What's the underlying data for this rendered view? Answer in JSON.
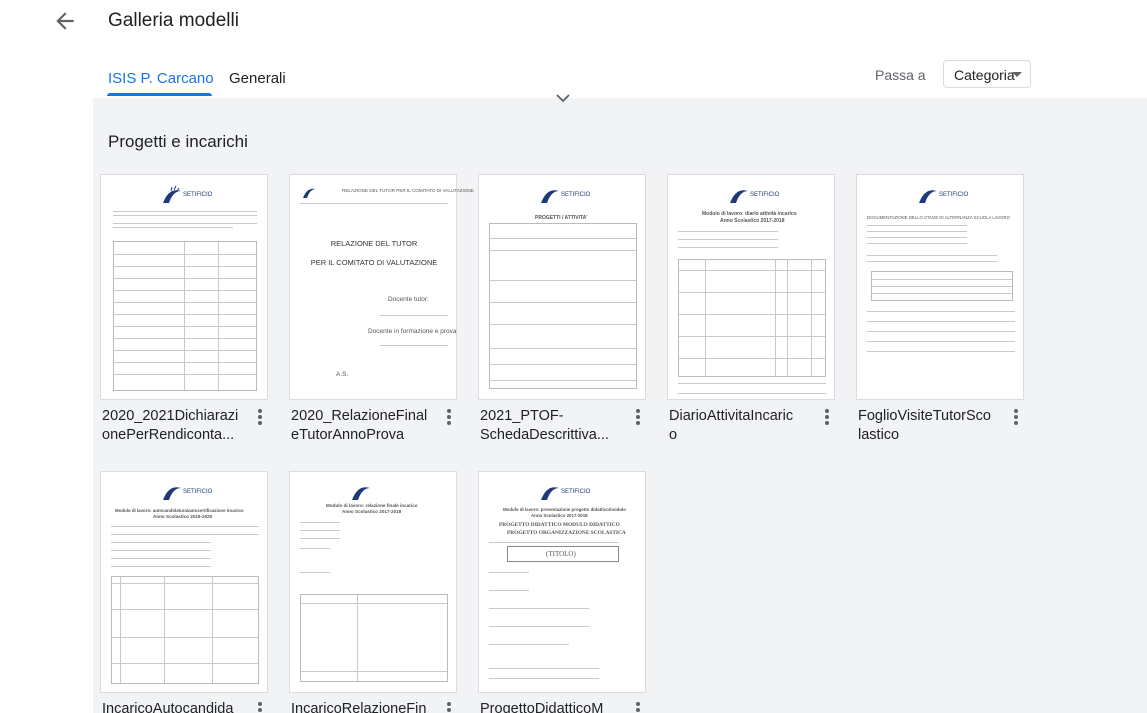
{
  "header": {
    "title": "Galleria modelli"
  },
  "tabs": [
    {
      "label": "ISIS P. Carcano",
      "active": true
    },
    {
      "label": "Generali",
      "active": false
    }
  ],
  "jump": {
    "label": "Passa a",
    "selected": "Categoria"
  },
  "section": {
    "title": "Progetti e incarichi"
  },
  "templates": [
    {
      "name_line1": "2020_2021Dichiarazi",
      "name_line2": "onePerRendiconta..."
    },
    {
      "name_line1": "2020_RelazioneFinal",
      "name_line2": "eTutorAnnoProva"
    },
    {
      "name_line1": "2021_PTOF-",
      "name_line2": "SchedaDescrittiva..."
    },
    {
      "name_line1": "DiarioAttivitaIncaric",
      "name_line2": "o"
    },
    {
      "name_line1": "FoglioVisiteTutorSco",
      "name_line2": "lastico"
    },
    {
      "name_line1": "IncaricoAutocandida",
      "name_line2": ""
    },
    {
      "name_line1": "IncaricoRelazioneFin",
      "name_line2": ""
    },
    {
      "name_line1": "ProgettoDidatticoM",
      "name_line2": ""
    }
  ],
  "thumb_text": {
    "logo": "SETIFICIO",
    "t2_header": "RELAZIONE DEL TUTOR PER IL COMITATO DI VALUTAZIONE",
    "t2_title1": "RELAZIONE DEL TUTOR",
    "t2_title2": "PER IL COMITATO DI VALUTAZIONE",
    "t2_sig1": "Docente tutor:",
    "t2_sig2": "Docente in formazione e prova",
    "t2_as": "A.S.",
    "t3_title": "PROGETTI / ATTIVITA'",
    "t4_title": "Modulo di lavoro: diario attività incarico",
    "t4_sub": "Anno Scolastico 2017-2018",
    "t5_title": "DOCUMENTAZIONE DELLO STAGE DI ALTERNANZA SCUOLA LAVORO",
    "t6_title": "Modulo di lavoro: autocandidatura/autocertificazione incarico",
    "t6_sub": "Anno Scolastico 2019-2020",
    "t7_title": "Modulo di lavoro: relazione finale incarico",
    "t7_sub": "Anno Scolastico 2017-2018",
    "t8_title": "Modulo di lavoro: presentazione progetto didattico/modulo",
    "t8_sub": "Anno Scolastico 2017-2018",
    "t8_big1": "PROGETTO DIDATTICO   MODULO DIDATTICO",
    "t8_big2": "PROGETTO ORGANIZZAZIONE SCOLASTICA",
    "t8_titolo": "(TITOLO)"
  },
  "colors": {
    "accent": "#1a73e8",
    "background_gray": "#f1f3f4",
    "logo": "#1e3a78"
  }
}
